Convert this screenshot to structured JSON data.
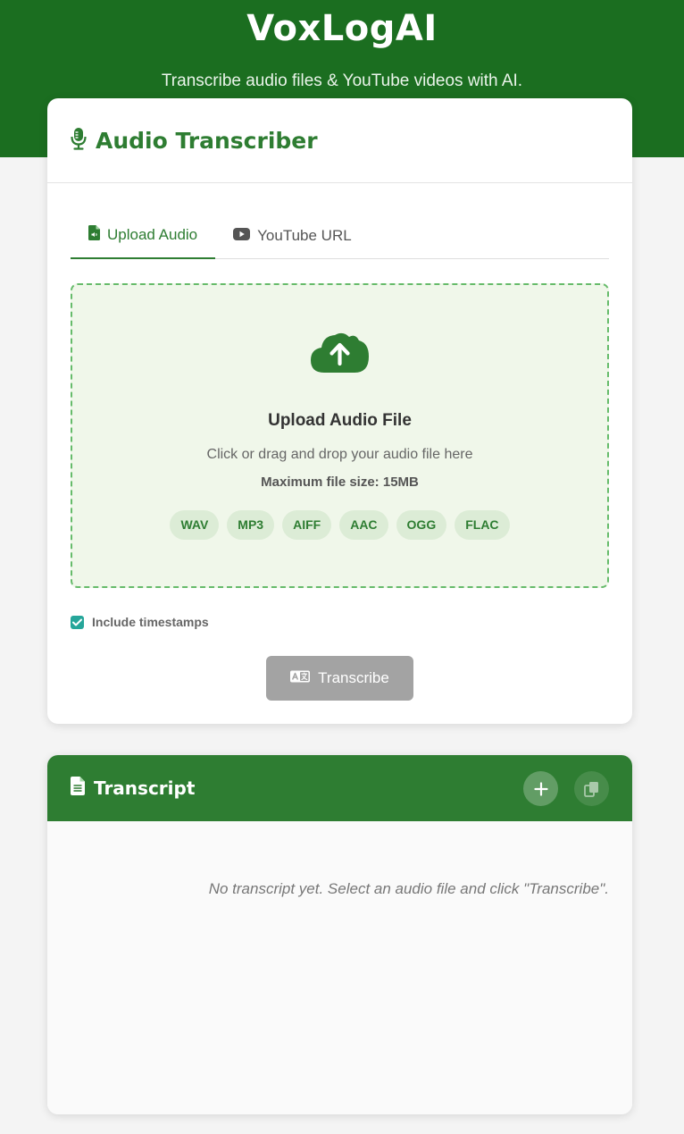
{
  "header": {
    "title": "VoxLogAI",
    "subtitle": "Transcribe audio files & YouTube videos with AI."
  },
  "transcriber": {
    "title": "Audio Transcriber",
    "icon": "microphone-icon",
    "tabs": [
      {
        "label": "Upload Audio",
        "icon": "file-audio-icon",
        "active": true
      },
      {
        "label": "YouTube URL",
        "icon": "youtube-icon",
        "active": false
      }
    ],
    "dropzone": {
      "icon": "cloud-upload-icon",
      "title": "Upload Audio File",
      "subtitle": "Click or drag and drop your audio file here",
      "max_size": "Maximum file size: 15MB",
      "formats": [
        "WAV",
        "MP3",
        "AIFF",
        "AAC",
        "OGG",
        "FLAC"
      ]
    },
    "timestamps": {
      "label": "Include timestamps",
      "checked": true
    },
    "transcribe_button": {
      "label": "Transcribe",
      "icon": "language-icon"
    }
  },
  "transcript": {
    "title": "Transcript",
    "icon": "file-text-icon",
    "add_icon": "plus-icon",
    "copy_icon": "copy-icon",
    "empty_message": "No transcript yet. Select an audio file and click \"Transcribe\"."
  },
  "colors": {
    "header_bg": "#1b6e20",
    "accent": "#2e7d32",
    "dropzone_bg": "#f0f7ea",
    "dropzone_border": "#66bb6a",
    "checkbox": "#26a69a",
    "button_disabled": "#a3a3a3"
  }
}
